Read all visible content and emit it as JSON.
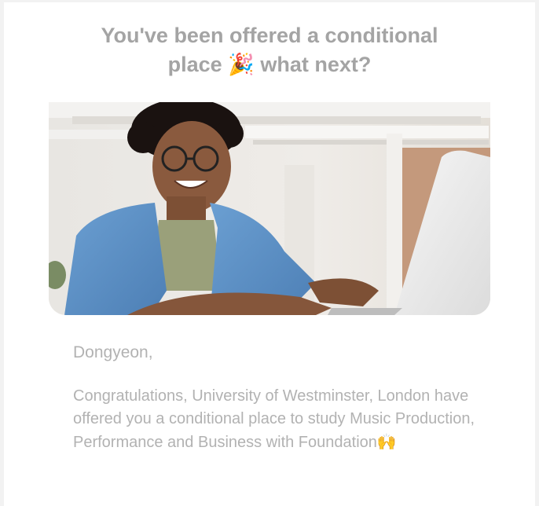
{
  "email": {
    "headline_line1": "You've been offered a conditional",
    "headline_line2_start": "place",
    "headline_emoji": "🎉",
    "headline_line2_end": "what next?",
    "greeting": "Dongyeon,",
    "body": "Congratulations, University of Westminster, London have offered you a conditional place to study Music Production, Performance and Business with Foundation",
    "body_emoji": "🙌"
  },
  "hero_image": {
    "icon": "photo-student-laptop",
    "subject": "smiling student with glasses using laptop"
  },
  "colors": {
    "background": "#f2f2f2",
    "card": "#ffffff",
    "headline": "#a4a4a4",
    "body_text": "#b2b2b2",
    "shirt": "#5b8fc4"
  }
}
